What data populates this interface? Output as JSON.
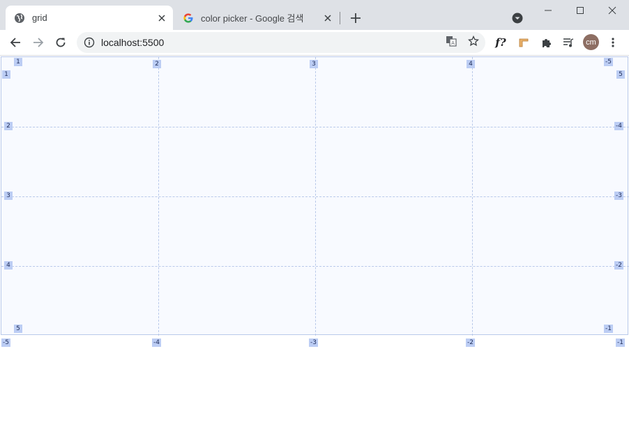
{
  "tabs": [
    {
      "title": "grid",
      "icon": "globe-icon",
      "active": true
    },
    {
      "title": "color picker - Google 검색",
      "icon": "google-icon",
      "active": false
    }
  ],
  "address_bar": {
    "url": "localhost:5500"
  },
  "profile": {
    "initials": "cm",
    "color": "#8d6e63"
  },
  "extensions": [
    "fonts-ext-icon",
    "ruler-ext-icon",
    "puzzle-icon",
    "media-control-icon"
  ],
  "extension_font_label": "f?",
  "grid_overlay": {
    "columns": 4,
    "rows": 4,
    "accent": "#bccdf4",
    "top_column_labels": [
      "1",
      "2",
      "3",
      "4",
      "-5"
    ],
    "bottom_column_labels": [
      "-5",
      "-4",
      "-3",
      "-2",
      "-1"
    ],
    "left_row_labels": [
      "1",
      "2",
      "3",
      "4",
      "5"
    ],
    "right_row_labels": [
      "5",
      "-4",
      "-3",
      "-2",
      "-1"
    ]
  }
}
